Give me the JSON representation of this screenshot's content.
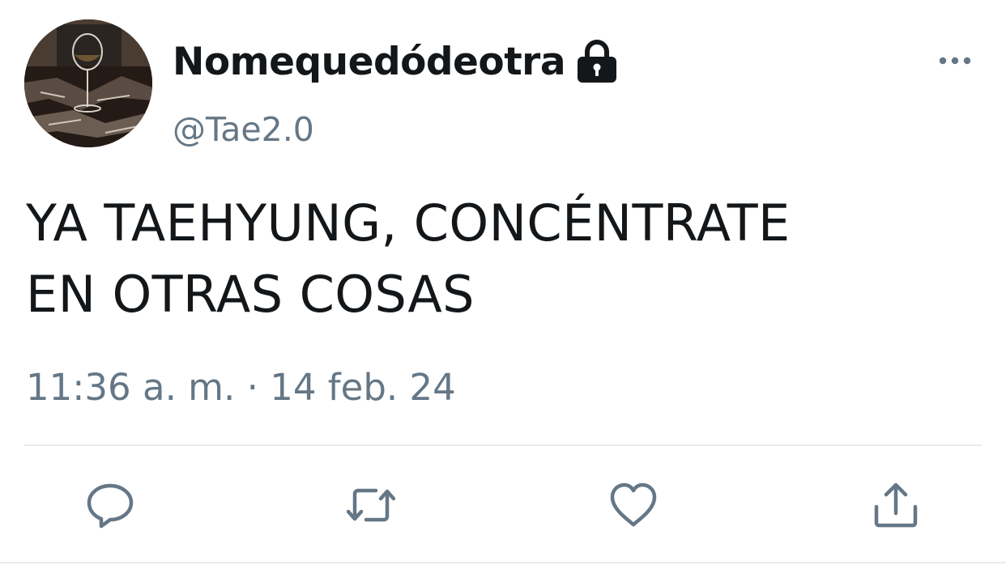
{
  "tweet": {
    "display_name": "Nomequedódeotra",
    "handle": "@Tae2.0",
    "text_line1": "YA TAEHYUNG, CONCÉNTRATE",
    "text_line2": "EN OTRAS COSAS",
    "timestamp": "11:36 a. m. · 14 feb. 24",
    "protected_icon": "lock-icon",
    "more_icon": "more-horizontal-icon"
  },
  "actions": [
    {
      "name": "reply",
      "icon": "reply-icon"
    },
    {
      "name": "retweet",
      "icon": "retweet-icon"
    },
    {
      "name": "like",
      "icon": "heart-icon"
    },
    {
      "name": "share",
      "icon": "share-icon"
    }
  ],
  "colors": {
    "text": "#14171a",
    "secondary": "#657786",
    "divider": "#e6ecf0"
  }
}
